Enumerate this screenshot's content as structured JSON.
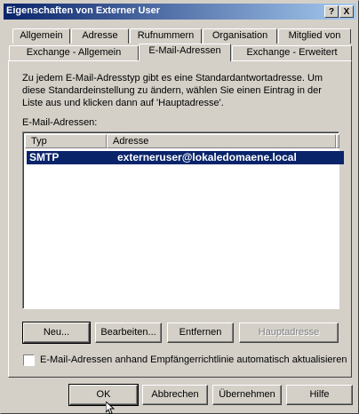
{
  "window": {
    "title": "Eigenschaften von Externer User",
    "help_label": "?",
    "close_label": "X"
  },
  "tabs_back": [
    {
      "label": "Allgemein"
    },
    {
      "label": "Adresse"
    },
    {
      "label": "Rufnummern"
    },
    {
      "label": "Organisation"
    },
    {
      "label": "Mitglied von"
    }
  ],
  "tabs_front": [
    {
      "label": "Exchange - Allgemein"
    },
    {
      "label": "E-Mail-Adressen",
      "active": true
    },
    {
      "label": "Exchange - Erweitert"
    }
  ],
  "description": "Zu jedem E-Mail-Adresstyp gibt es eine Standardantwortadresse. Um diese Standardeinstellung zu ändern, wählen Sie einen Eintrag in der Liste aus und klicken dann auf 'Hauptadresse'.",
  "addresses_label": "E-Mail-Adressen:",
  "list": {
    "columns": [
      "Typ",
      "Adresse"
    ],
    "rows": [
      {
        "type": "SMTP",
        "address": "externeruser@lokaledomaene.local",
        "selected": true
      }
    ]
  },
  "list_buttons": {
    "new": "Neu...",
    "edit": "Bearbeiten...",
    "remove": "Entfernen",
    "primary": "Hauptadresse"
  },
  "auto_update_label": "E-Mail-Adressen anhand Empfängerrichtlinie automatisch aktualisieren",
  "auto_update_checked": false,
  "dialog_buttons": {
    "ok": "OK",
    "cancel": "Abbrechen",
    "apply": "Übernehmen",
    "help": "Hilfe"
  },
  "colors": {
    "face": "#d4d0c8",
    "title_start": "#0a246a",
    "title_end": "#a6caf0",
    "selection": "#0a246a"
  }
}
